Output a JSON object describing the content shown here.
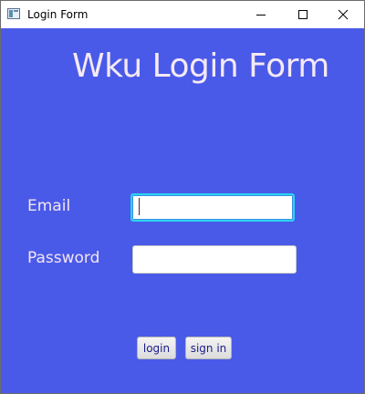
{
  "window": {
    "title": "Login Form",
    "controls": {
      "minimize": "minimize-icon",
      "maximize": "maximize-icon",
      "close": "close-icon"
    }
  },
  "form": {
    "title": "Wku Login Form",
    "email_label": "Email",
    "email_value": "",
    "password_label": "Password",
    "password_value": "",
    "login_label": "login",
    "signin_label": "sign in"
  },
  "colors": {
    "background": "#4a5ae8",
    "text": "#f5e9f4",
    "focus_border": "#2bd3ee",
    "button_text": "#1c1c8a"
  }
}
